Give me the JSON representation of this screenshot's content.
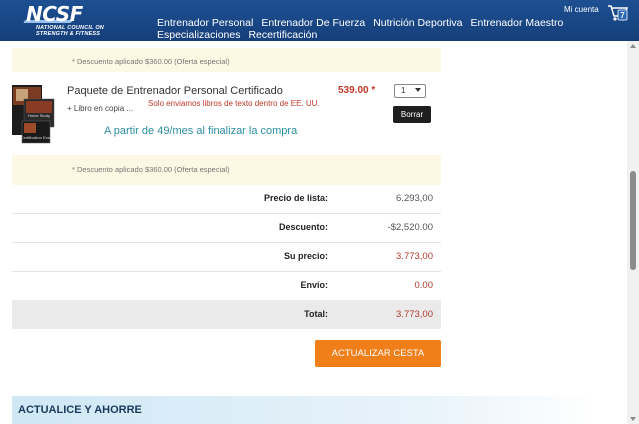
{
  "header": {
    "logo_text": "NCSF",
    "logo_subtitle": "NATIONAL COUNCIL ON\nSTRENGTH & FITNESS",
    "nav": [
      "Entrenador Personal",
      "Entrenador De Fuerza",
      "Nutrición Deportiva",
      "Entrenador Maestro",
      "Especializaciones",
      "Recertificación"
    ],
    "account_label": "Mi cuenta",
    "cart_count": "7"
  },
  "cart": {
    "discount_note_top": "* Descuento aplicado $360.00 (Oferta especial)",
    "product": {
      "title": "Paquete de Entrenador Personal Certificado",
      "price": "539.00 *",
      "subtitle": "+ Libro en copia ...",
      "shipping_note": "Solo enviamos libros de texto dentro de EE. UU.",
      "financing": "A partir de 49/mes al finalizar la compra",
      "quantity": "1",
      "remove_label": "Borrar",
      "thumb_labels": [
        "Home Study",
        "Certification Exam"
      ]
    },
    "discount_note_bottom": "* Descuento aplicado $360.00 (Oferta especial)"
  },
  "summary": {
    "rows": [
      {
        "label": "Precio de lista:",
        "value": "6.293,00"
      },
      {
        "label": "Descuento:",
        "value": "-$2,520.00"
      },
      {
        "label": "Su precio:",
        "value": "3.773,00"
      },
      {
        "label": "Envío:",
        "value": "0.00"
      },
      {
        "label": "Total:",
        "value": "3.773,00"
      }
    ]
  },
  "actions": {
    "update_label": "ACTUALIZAR CESTA"
  },
  "upgrade": {
    "title": "ACTUALICE Y AHORRE"
  },
  "colors": {
    "header_blue": "#1d4f92",
    "accent_orange": "#f07f1a",
    "price_red": "#c0392b",
    "finance_teal": "#2b8ea0"
  }
}
